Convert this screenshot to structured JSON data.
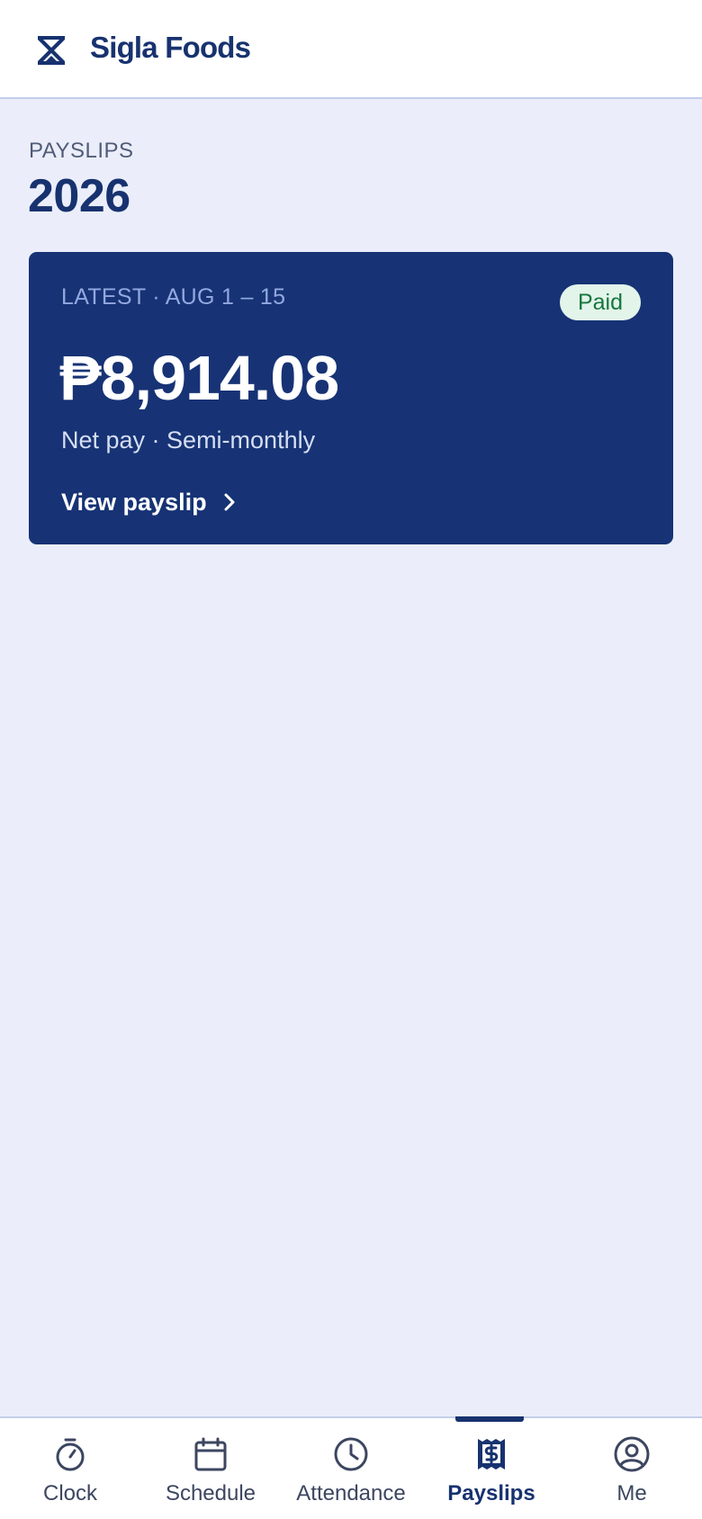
{
  "header": {
    "brand_name": "Sigla Foods",
    "logo_icon": "hourglass-logo-icon"
  },
  "page": {
    "section_label": "PAYSLIPS",
    "year": "2026"
  },
  "latest_payslip": {
    "period": "LATEST · AUG 1 – 15",
    "status": "Paid",
    "amount": "₱8,914.08",
    "subtitle": "Net pay · Semi-monthly",
    "view_label": "View payslip"
  },
  "tabs": [
    {
      "label": "Clock",
      "icon": "stopwatch-icon",
      "active": false
    },
    {
      "label": "Schedule",
      "icon": "calendar-icon",
      "active": false
    },
    {
      "label": "Attendance",
      "icon": "clock-icon",
      "active": false
    },
    {
      "label": "Payslips",
      "icon": "receipt-dollar-icon",
      "active": true
    },
    {
      "label": "Me",
      "icon": "user-circle-icon",
      "active": false
    }
  ],
  "colors": {
    "brand": "#17326f",
    "card_background": "#173375",
    "page_background": "#ebeefa",
    "paid_badge_bg": "#e3f5ea",
    "paid_badge_text": "#17773f"
  }
}
